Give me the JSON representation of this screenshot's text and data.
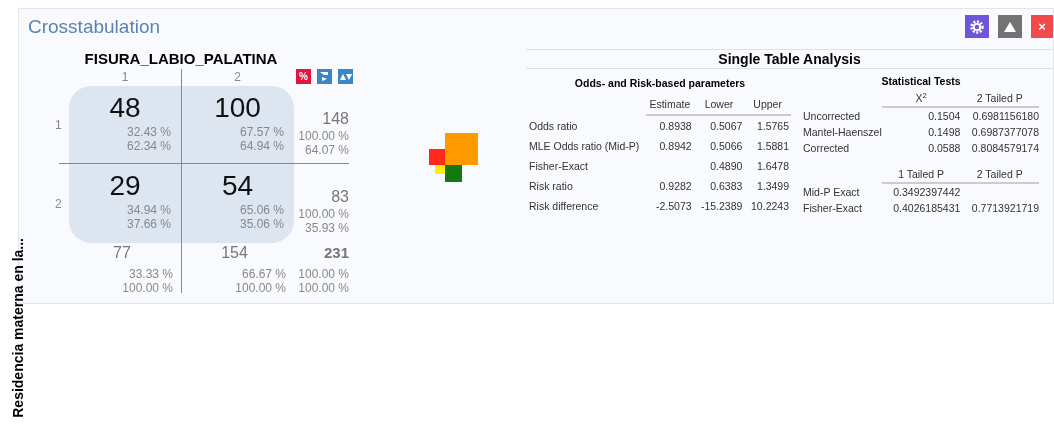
{
  "window": {
    "title": "Crosstabulation"
  },
  "toolbar": {
    "close_label": "×"
  },
  "crosstab": {
    "column_variable": "FISURA_LABIO_PALATINA",
    "row_variable": "Residencia materna en la...",
    "percent_toggle": "%",
    "column_headers": [
      "1",
      "2"
    ],
    "rows": [
      {
        "label": "1",
        "cells": [
          {
            "count": "48",
            "row_pct": "32.43 %",
            "col_pct": "62.34 %"
          },
          {
            "count": "100",
            "row_pct": "67.57 %",
            "col_pct": "64.94 %"
          }
        ],
        "total": {
          "count": "148",
          "row_pct": "100.00 %",
          "col_pct": "64.07 %"
        }
      },
      {
        "label": "2",
        "cells": [
          {
            "count": "29",
            "row_pct": "34.94 %",
            "col_pct": "37.66 %"
          },
          {
            "count": "54",
            "row_pct": "65.06 %",
            "col_pct": "35.06 %"
          }
        ],
        "total": {
          "count": "83",
          "row_pct": "100.00 %",
          "col_pct": "35.93 %"
        }
      }
    ],
    "column_totals": [
      {
        "count": "77",
        "row_pct": "33.33 %",
        "col_pct": "100.00 %"
      },
      {
        "count": "154",
        "row_pct": "66.67 %",
        "col_pct": "100.00 %"
      }
    ],
    "grand_total": {
      "count": "231",
      "row_pct": "100.00 %",
      "col_pct": "100.00 %"
    }
  },
  "analysis": {
    "title": "Single Table Analysis",
    "odds_risk": {
      "title": "Odds- and Risk-based parameters",
      "columns": [
        "Estimate",
        "Lower",
        "Upper"
      ],
      "rows": [
        {
          "label": "Odds ratio",
          "estimate": "0.8938",
          "lower": "0.5067",
          "upper": "1.5765"
        },
        {
          "label": "MLE Odds ratio (Mid-P)",
          "estimate": "0.8942",
          "lower": "0.5066",
          "upper": "1.5881"
        },
        {
          "label": "Fisher-Exact",
          "lower": "0.4890",
          "upper": "1.6478"
        },
        {
          "label": "Risk ratio",
          "estimate": "0.9282",
          "lower": "0.6383",
          "upper": "1.3499"
        },
        {
          "label": "Risk difference",
          "estimate": "-2.5073",
          "lower": "-15.2389",
          "upper": "10.2243"
        }
      ]
    },
    "statistical_tests": {
      "title": "Statistical Tests",
      "chi_columns": [
        "X$^{2}$",
        "2 Tailed P"
      ],
      "chi_rows": [
        {
          "label": "Uncorrected",
          "chi2": "0.1504",
          "two_tailed": "0.6981156180"
        },
        {
          "label": "Mantel-Haenszel",
          "chi2": "0.1498",
          "two_tailed": "0.6987377078"
        },
        {
          "label": "Corrected",
          "chi2": "0.0588",
          "two_tailed": "0.8084579174"
        }
      ],
      "exact_columns": [
        "1 Tailed P",
        "2 Tailed P"
      ],
      "exact_rows": [
        {
          "label": "Mid-P Exact",
          "one_tailed": "0.3492397442"
        },
        {
          "label": "Fisher-Exact",
          "one_tailed": "0.4026185431",
          "two_tailed": "0.7713921719"
        }
      ]
    }
  }
}
